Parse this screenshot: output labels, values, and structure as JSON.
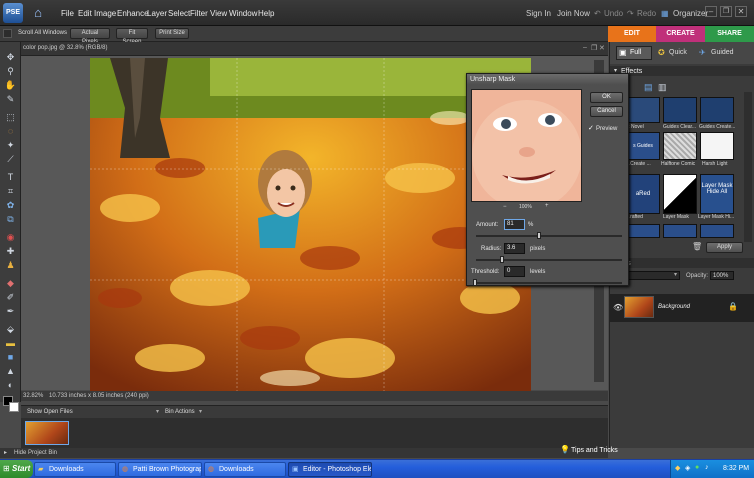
{
  "menubar": {
    "logo": "PSE",
    "items": [
      "File",
      "Edit",
      "Image",
      "Enhance",
      "Layer",
      "Select",
      "Filter",
      "View",
      "Window",
      "Help"
    ],
    "sign_in": "Sign In",
    "join_now": "Join Now",
    "undo": "Undo",
    "redo": "Redo",
    "organizer": "Organizer"
  },
  "optionsbar": {
    "scroll_all": "Scroll All Windows",
    "actual_pixels": "Actual Pixels",
    "fit_screen": "Fit Screen",
    "print_size": "Print Size"
  },
  "mode_tabs": {
    "edit": "EDIT",
    "create": "CREATE",
    "share": "SHARE"
  },
  "edit_modes": {
    "full": "Full",
    "quick": "Quick",
    "guided": "Guided"
  },
  "document": {
    "tab_title": "color pop.jpg @ 32.8% (RGB/8)",
    "zoom": "32.82%",
    "size_info": "10.733 inches x 8.05 inches (240 ppi)"
  },
  "project_bin": {
    "show_label": "Show Open Files",
    "bin_actions": "Bin Actions",
    "hide_label": "Hide Project Bin"
  },
  "panels": {
    "effects_title": "Effects",
    "effects": [
      {
        "label": "ic Novel",
        "bg": "#2a4a7a"
      },
      {
        "label": "Guides Clear...",
        "bg": "#1f3f6f"
      },
      {
        "label": "Guides Create...",
        "bg": "#1f3f6f"
      },
      {
        "label": "...Create ...",
        "bg": "#2a4e8a"
      },
      {
        "label": "Halftone Comic",
        "bg": "#e9e9e9"
      },
      {
        "label": "Harsh Light",
        "bg": "#f5f5f5"
      },
      {
        "label": "...rafted",
        "bg": "#22427a"
      },
      {
        "label": "Layer Mask",
        "bg": "#101010"
      },
      {
        "label": "Layer Mask Hi...",
        "bg": "#28508e"
      }
    ],
    "effect_overlay_texts": [
      "s Guides",
      "aRed",
      "Layer Mask Hide All"
    ],
    "apply": "Apply",
    "layers_title": "ers",
    "opacity_label": "Opacity:",
    "opacity_value": "100%",
    "layer_name": "Background"
  },
  "dialog": {
    "title": "Unsharp Mask",
    "ok": "OK",
    "cancel": "Cancel",
    "preview_label": "Preview",
    "preview_checked": true,
    "zoom": "100%",
    "zoom_out": "−",
    "zoom_in": "+",
    "amount_label": "Amount:",
    "amount_value": "81",
    "amount_unit": "%",
    "radius_label": "Radius:",
    "radius_value": "3.6",
    "radius_unit": "pixels",
    "threshold_label": "Threshold:",
    "threshold_value": "0",
    "threshold_unit": "levels"
  },
  "taskbar": {
    "start": "Start",
    "buttons": [
      "Downloads",
      "Patti Brown Photography...",
      "Downloads",
      "Editor - Photoshop Ele..."
    ],
    "active_index": 3,
    "tips": "Tips and Tricks",
    "clock": "8:32 PM"
  },
  "colors": {
    "edit_tab": "#e8731a",
    "create_tab": "#c0307a",
    "share_tab": "#2e9a4a",
    "accent": "#2f6be0"
  }
}
